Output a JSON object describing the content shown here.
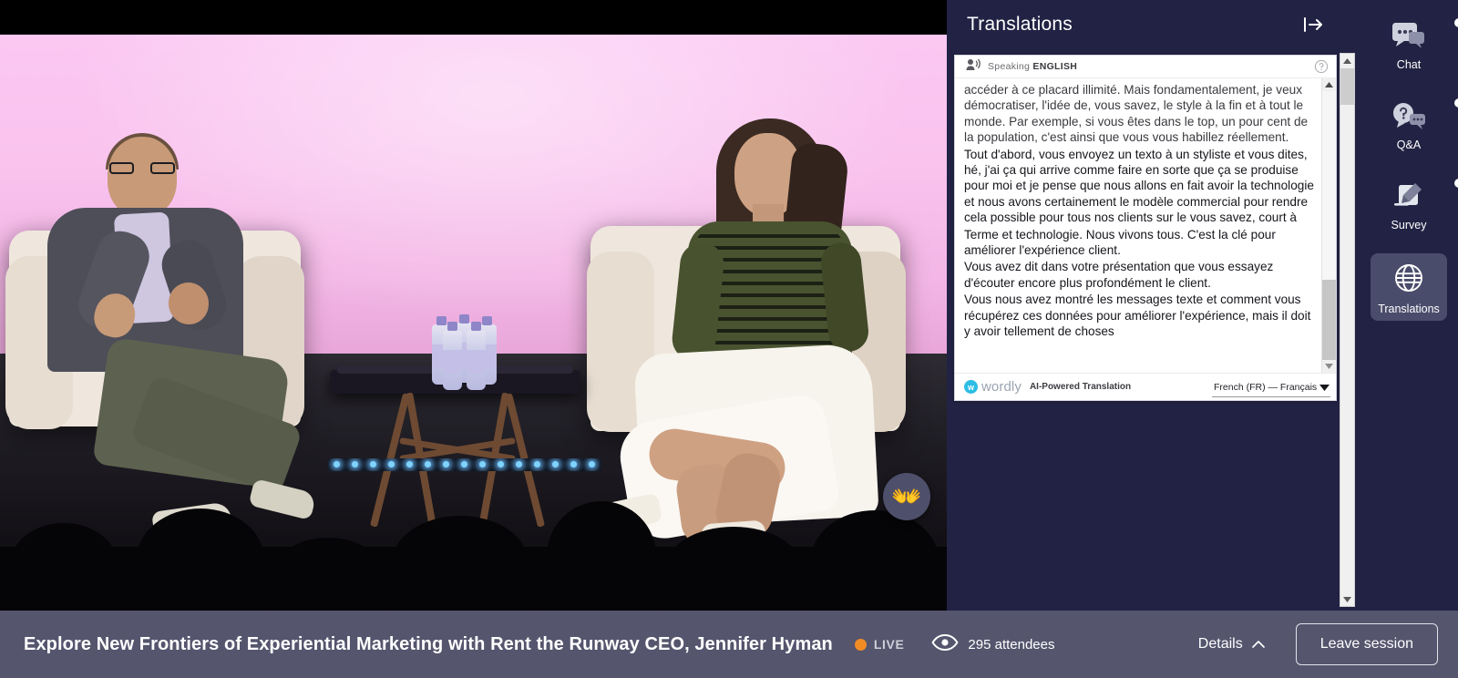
{
  "panel": {
    "title": "Translations",
    "collapse_icon": "collapse-panel-right-icon",
    "card": {
      "speaking_prefix": "Speaking",
      "speaking_language": "ENGLISH",
      "help_icon": "help-circle-icon",
      "speaker_icon": "speaker-person-icon",
      "transcript": [
        "accéder à ce placard illimité. Mais fondamentalement, je veux démocratiser, l'idée de, vous savez, le style à la fin et à tout le monde. Par exemple, si vous êtes dans le top, un pour cent de la population, c'est ainsi que vous vous habillez réellement.",
        "Tout d'abord, vous envoyez un texto à un styliste et vous dites, hé, j'ai ça qui arrive comme faire en sorte que ça se produise pour moi et je pense que nous allons en fait avoir la technologie et nous avons certainement le modèle commercial pour rendre cela possible pour tous nos clients sur le vous savez, court à",
        "Terme et technologie. Nous vivons tous. C'est la clé pour améliorer l'expérience client.",
        "Vous avez dit dans votre présentation que vous essayez d'écouter encore plus profondément le client.",
        "Vous nous avez montré les messages texte et comment vous récupérez ces données pour améliorer l'expérience, mais il doit y avoir tellement de choses"
      ],
      "brand_name": "wordly",
      "brand_mark": "w",
      "brand_tagline": "AI-Powered Translation",
      "language_selected": "French (FR) — Français (F",
      "language_caret_icon": "caret-down-icon"
    }
  },
  "rail": {
    "items": [
      {
        "label": "Chat",
        "icon": "chat-bubbles-icon",
        "badge": true,
        "active": false
      },
      {
        "label": "Q&A",
        "icon": "question-bubble-icon",
        "badge": true,
        "active": false
      },
      {
        "label": "Survey",
        "icon": "survey-clipboard-pen-icon",
        "badge": true,
        "active": false
      },
      {
        "label": "Translations",
        "icon": "globe-icon",
        "badge": false,
        "active": true
      }
    ]
  },
  "stage": {
    "reaction_button": {
      "icon": "clapping-hands-icon",
      "glyph": "👐"
    }
  },
  "bottom": {
    "session_title": "Explore New Frontiers of Experiential Marketing with Rent the Runway CEO, Jennifer Hyman",
    "live_label": "LIVE",
    "live_dot_color": "#f08c24",
    "attendees_icon": "eye-icon",
    "attendees_text": "295 attendees",
    "details_label": "Details",
    "details_caret_icon": "caret-up-icon",
    "leave_label": "Leave session"
  },
  "colors": {
    "panel_bg": "#222244",
    "bottom_bar": "#55556e",
    "rail_active": "#4a4c6b",
    "accent_live": "#f08c24",
    "wordly_blue": "#2dbde5"
  }
}
